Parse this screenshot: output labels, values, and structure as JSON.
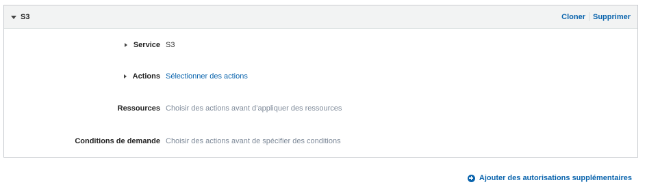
{
  "panel": {
    "title": "S3",
    "clone_label": "Cloner",
    "delete_label": "Supprimer"
  },
  "rows": [
    {
      "label": "Service",
      "value": "S3",
      "expandable": true,
      "value_style": "plain"
    },
    {
      "label": "Actions",
      "value": "Sélectionner des actions",
      "expandable": true,
      "value_style": "link"
    },
    {
      "label": "Ressources",
      "value": "Choisir des actions avant d’appliquer des ressources",
      "expandable": false,
      "value_style": "muted"
    },
    {
      "label": "Conditions de demande",
      "value": "Choisir des actions avant de spécifier des conditions",
      "expandable": false,
      "value_style": "muted"
    }
  ],
  "footer": {
    "add_permissions_label": "Ajouter des autorisations supplémentaires"
  },
  "colors": {
    "link": "#0a64ad",
    "muted": "#7d8998",
    "header_bg": "#f2f3f3"
  }
}
